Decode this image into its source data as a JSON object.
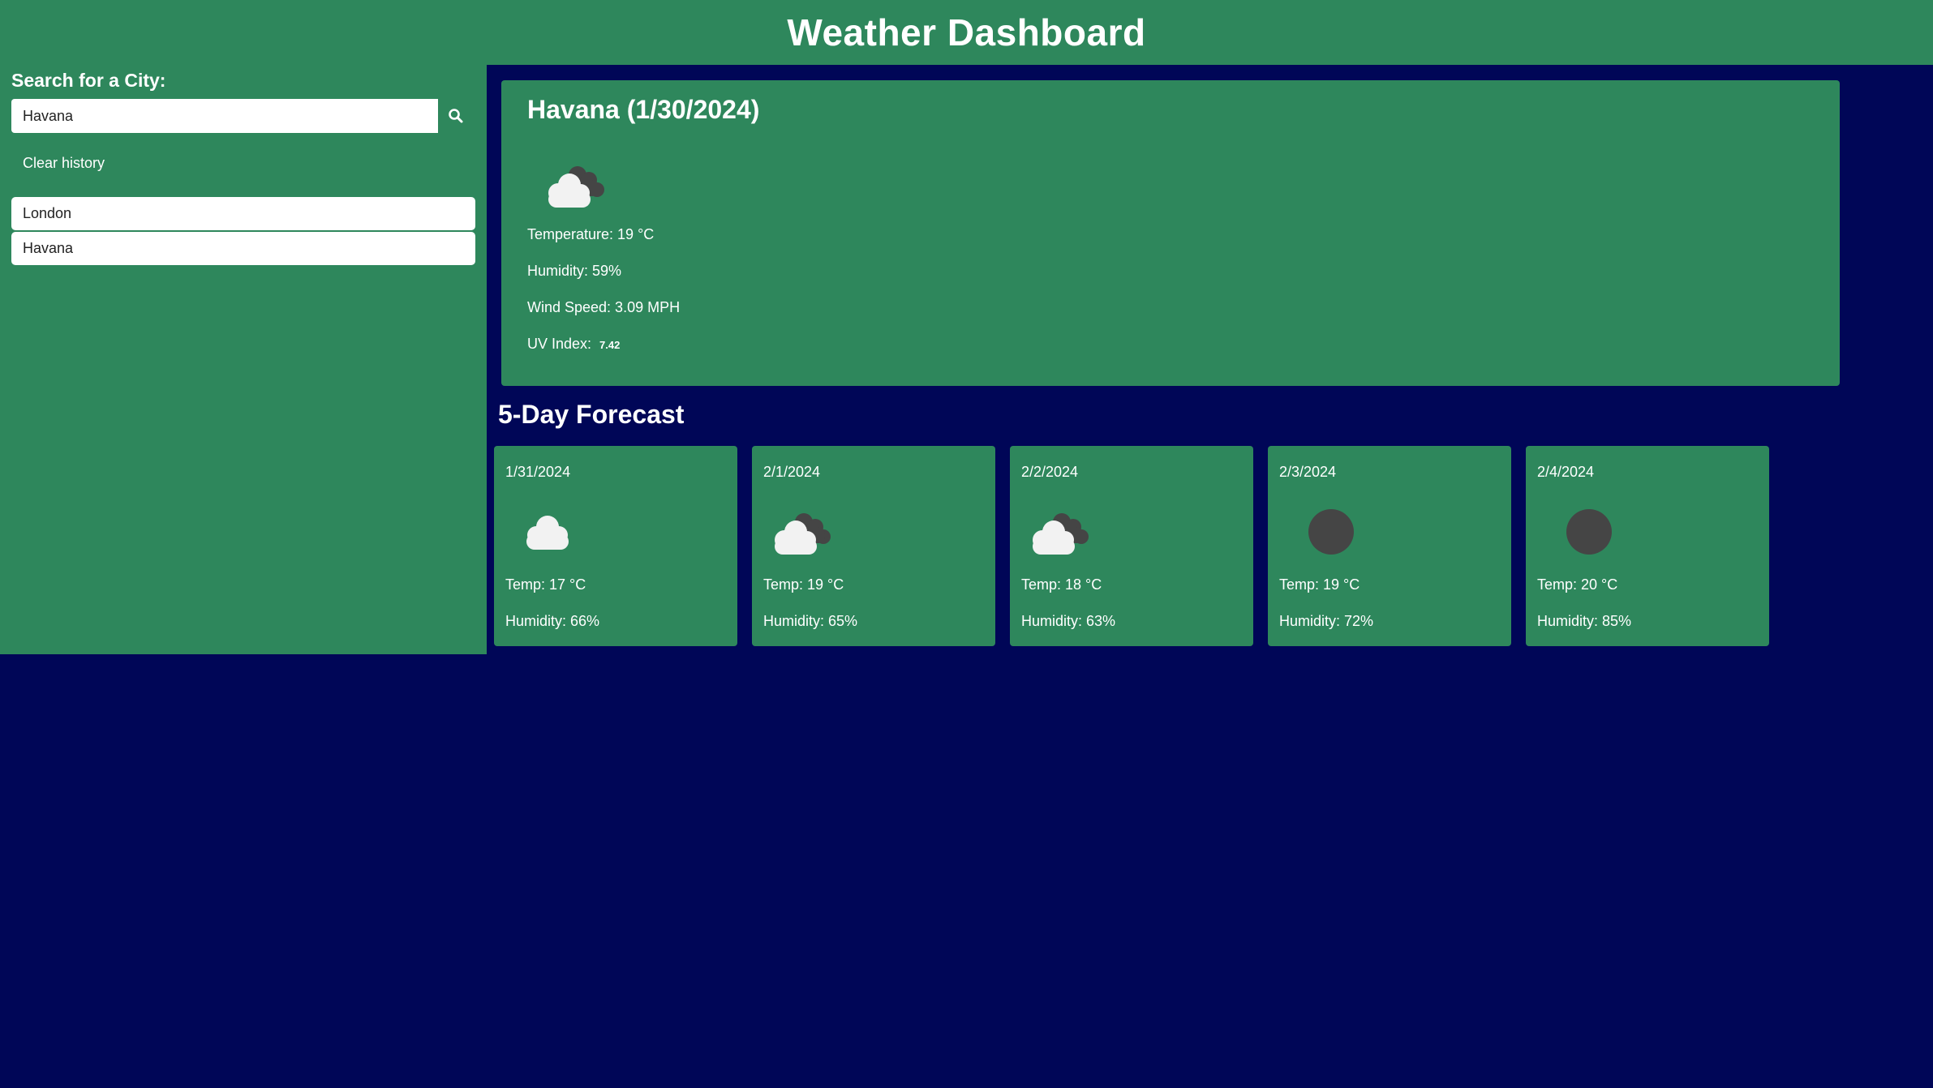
{
  "header": {
    "title": "Weather Dashboard"
  },
  "sidebar": {
    "search_label": "Search for a City:",
    "search_value": "Havana",
    "search_icon": "search-icon",
    "clear_label": "Clear history",
    "history": [
      "London",
      "Havana"
    ]
  },
  "current": {
    "title": "Havana (1/30/2024)",
    "icon": "broken-clouds-icon",
    "temperature": "Temperature: 19 °C",
    "humidity": "Humidity: 59%",
    "wind": "Wind Speed: 3.09 MPH",
    "uv_label": "UV Index:",
    "uv_value": "7.42"
  },
  "forecast": {
    "title": "5-Day Forecast",
    "days": [
      {
        "date": "1/31/2024",
        "icon": "cloud-icon",
        "temp": "Temp: 17 °C",
        "humidity": "Humidity: 66%"
      },
      {
        "date": "2/1/2024",
        "icon": "broken-clouds-icon",
        "temp": "Temp: 19 °C",
        "humidity": "Humidity: 65%"
      },
      {
        "date": "2/2/2024",
        "icon": "broken-clouds-icon",
        "temp": "Temp: 18 °C",
        "humidity": "Humidity: 63%"
      },
      {
        "date": "2/3/2024",
        "icon": "overcast-icon",
        "temp": "Temp: 19 °C",
        "humidity": "Humidity: 72%"
      },
      {
        "date": "2/4/2024",
        "icon": "overcast-icon",
        "temp": "Temp: 20 °C",
        "humidity": "Humidity: 85%"
      }
    ]
  },
  "colors": {
    "background": "#000657",
    "panel": "#2e875c",
    "text": "#ffffff"
  }
}
